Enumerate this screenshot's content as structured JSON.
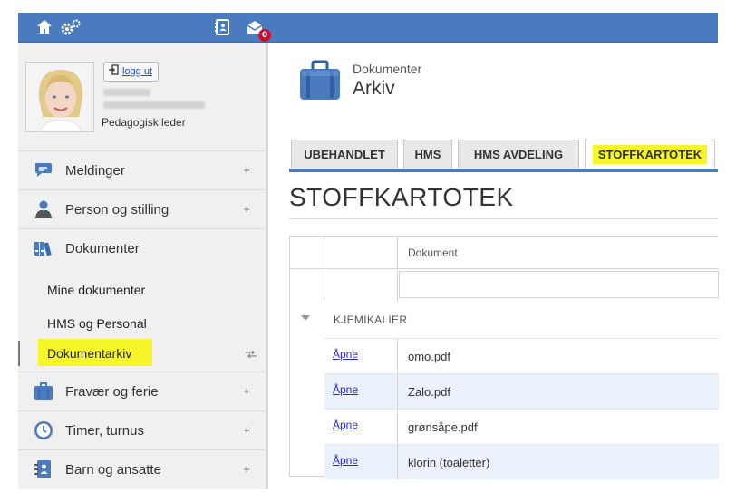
{
  "topbar": {
    "icons": [
      "home-icon",
      "settings-icon",
      "address-book-icon",
      "envelope-icon"
    ],
    "mail_badge": "0",
    "colors": {
      "bar": "#4b7bbf",
      "badge": "#c8102e"
    }
  },
  "user": {
    "logout_label": "logg ut",
    "role": "Pedagogisk leder"
  },
  "sidebar": {
    "menu": [
      {
        "label": "Meldinger",
        "plus": "+"
      },
      {
        "label": "Person og stilling",
        "plus": "+"
      },
      {
        "label": "Dokumenter",
        "plus": ""
      },
      {
        "label": "Fravær og ferie",
        "plus": "+"
      },
      {
        "label": "Timer, turnus",
        "plus": "+"
      },
      {
        "label": "Barn og ansatte",
        "plus": "+"
      }
    ],
    "submenu": [
      {
        "label": "Mine dokumenter"
      },
      {
        "label": "HMS og Personal"
      },
      {
        "label": "Dokumentarkiv"
      }
    ],
    "highlight_color": "#f5f52a"
  },
  "header": {
    "subtitle": "Dokumenter",
    "title": "Arkiv"
  },
  "tabs": [
    {
      "label": "UBEHANDLET"
    },
    {
      "label": "HMS"
    },
    {
      "label": "HMS AVDELING"
    },
    {
      "label": "STOFFKARTOTEK"
    }
  ],
  "page_title": "STOFFKARTOTEK",
  "grid": {
    "column_header": "Dokument",
    "group_label": "KJEMIKALIER",
    "rows": [
      {
        "action": "Åpne",
        "document": "omo.pdf"
      },
      {
        "action": "Åpne",
        "document": "Zalo.pdf"
      },
      {
        "action": "Åpne",
        "document": "grønsåpe.pdf"
      },
      {
        "action": "Åpne",
        "document": "klorin (toaletter)"
      }
    ]
  }
}
